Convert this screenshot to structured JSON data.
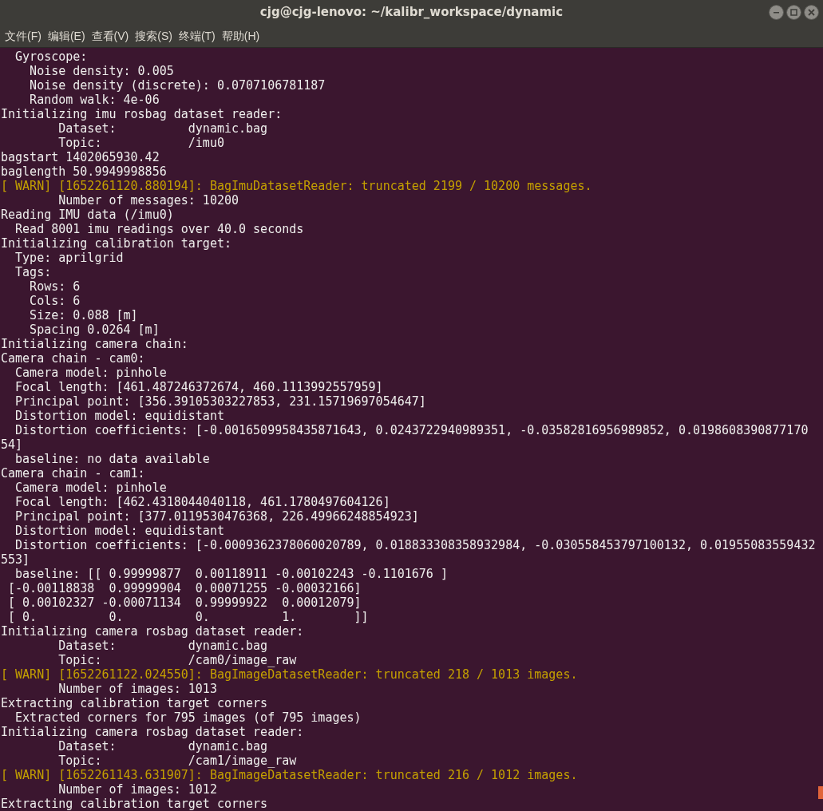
{
  "window": {
    "title": "cjg@cjg-lenovo: ~/kalibr_workspace/dynamic"
  },
  "menu": [
    "文件(F)",
    "编辑(E)",
    "查看(V)",
    "搜索(S)",
    "终端(T)",
    "帮助(H)"
  ],
  "lines": [
    {
      "kind": "normal",
      "text": "  Gyroscope:"
    },
    {
      "kind": "normal",
      "text": "    Noise density: 0.005"
    },
    {
      "kind": "normal",
      "text": "    Noise density (discrete): 0.0707106781187"
    },
    {
      "kind": "normal",
      "text": "    Random walk: 4e-06"
    },
    {
      "kind": "normal",
      "text": "Initializing imu rosbag dataset reader:"
    },
    {
      "kind": "normal",
      "text": "        Dataset:          dynamic.bag"
    },
    {
      "kind": "normal",
      "text": "        Topic:            /imu0"
    },
    {
      "kind": "normal",
      "text": "bagstart 1402065930.42"
    },
    {
      "kind": "normal",
      "text": "baglength 50.9949998856"
    },
    {
      "kind": "warn",
      "text": "[ WARN] [1652261120.880194]: BagImuDatasetReader: truncated 2199 / 10200 messages."
    },
    {
      "kind": "normal",
      "text": "        Number of messages: 10200"
    },
    {
      "kind": "normal",
      "text": "Reading IMU data (/imu0)"
    },
    {
      "kind": "normal",
      "text": "  Read 8001 imu readings over 40.0 seconds"
    },
    {
      "kind": "normal",
      "text": "Initializing calibration target:"
    },
    {
      "kind": "normal",
      "text": "  Type: aprilgrid"
    },
    {
      "kind": "normal",
      "text": "  Tags: "
    },
    {
      "kind": "normal",
      "text": "    Rows: 6"
    },
    {
      "kind": "normal",
      "text": "    Cols: 6"
    },
    {
      "kind": "normal",
      "text": "    Size: 0.088 [m]"
    },
    {
      "kind": "normal",
      "text": "    Spacing 0.0264 [m]"
    },
    {
      "kind": "normal",
      "text": "Initializing camera chain:"
    },
    {
      "kind": "normal",
      "text": "Camera chain - cam0:"
    },
    {
      "kind": "normal",
      "text": "  Camera model: pinhole"
    },
    {
      "kind": "normal",
      "text": "  Focal length: [461.487246372674, 460.1113992557959]"
    },
    {
      "kind": "normal",
      "text": "  Principal point: [356.39105303227853, 231.15719697054647]"
    },
    {
      "kind": "normal",
      "text": "  Distortion model: equidistant"
    },
    {
      "kind": "normal",
      "text": "  Distortion coefficients: [-0.0016509958435871643, 0.0243722940989351, -0.03582816956989852, 0.0198608390877170"
    },
    {
      "kind": "normal",
      "text": "54]"
    },
    {
      "kind": "normal",
      "text": "  baseline: no data available"
    },
    {
      "kind": "normal",
      "text": "Camera chain - cam1:"
    },
    {
      "kind": "normal",
      "text": "  Camera model: pinhole"
    },
    {
      "kind": "normal",
      "text": "  Focal length: [462.4318044040118, 461.1780497604126]"
    },
    {
      "kind": "normal",
      "text": "  Principal point: [377.0119530476368, 226.49966248854923]"
    },
    {
      "kind": "normal",
      "text": "  Distortion model: equidistant"
    },
    {
      "kind": "normal",
      "text": "  Distortion coefficients: [-0.0009362378060020789, 0.018833308358932984, -0.030558453797100132, 0.01955083559432"
    },
    {
      "kind": "normal",
      "text": "553]"
    },
    {
      "kind": "normal",
      "text": "  baseline: [[ 0.99999877  0.00118911 -0.00102243 -0.1101676 ]"
    },
    {
      "kind": "normal",
      "text": " [-0.00118838  0.99999904  0.00071255 -0.00032166]"
    },
    {
      "kind": "normal",
      "text": " [ 0.00102327 -0.00071134  0.99999922  0.00012079]"
    },
    {
      "kind": "normal",
      "text": " [ 0.          0.          0.          1.        ]]"
    },
    {
      "kind": "normal",
      "text": "Initializing camera rosbag dataset reader:"
    },
    {
      "kind": "normal",
      "text": "        Dataset:          dynamic.bag"
    },
    {
      "kind": "normal",
      "text": "        Topic:            /cam0/image_raw"
    },
    {
      "kind": "warn",
      "text": "[ WARN] [1652261122.024550]: BagImageDatasetReader: truncated 218 / 1013 images."
    },
    {
      "kind": "normal",
      "text": "        Number of images: 1013"
    },
    {
      "kind": "normal",
      "text": "Extracting calibration target corners"
    },
    {
      "kind": "normal",
      "text": "  Extracted corners for 795 images (of 795 images)"
    },
    {
      "kind": "normal",
      "text": "Initializing camera rosbag dataset reader:"
    },
    {
      "kind": "normal",
      "text": "        Dataset:          dynamic.bag"
    },
    {
      "kind": "normal",
      "text": "        Topic:            /cam1/image_raw"
    },
    {
      "kind": "warn",
      "text": "[ WARN] [1652261143.631907]: BagImageDatasetReader: truncated 216 / 1012 images."
    },
    {
      "kind": "normal",
      "text": "        Number of images: 1012"
    },
    {
      "kind": "normal",
      "text": "Extracting calibration target corners"
    }
  ]
}
